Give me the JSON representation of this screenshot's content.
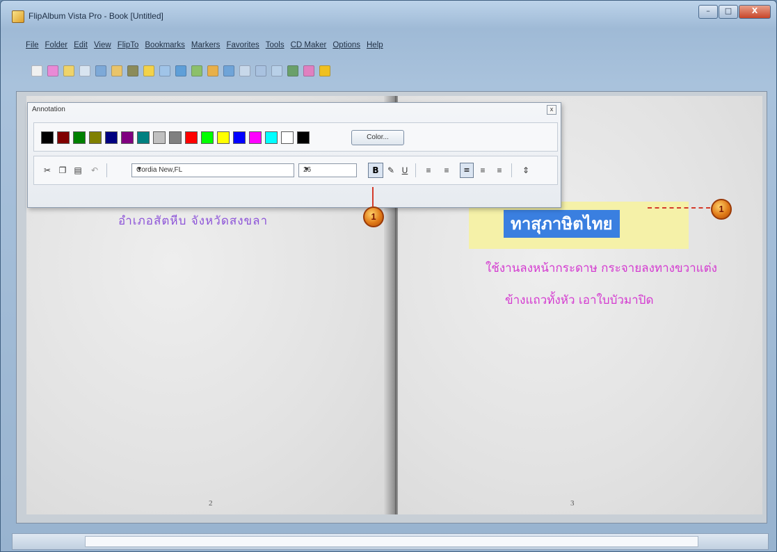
{
  "window": {
    "title": "FlipAlbum Vista Pro - Book [Untitled]",
    "controls": [
      "–",
      "□",
      "X"
    ]
  },
  "menu": {
    "items": [
      "File",
      "Folder",
      "Edit",
      "View",
      "FlipTo",
      "Bookmarks",
      "Markers",
      "Favorites",
      "Tools",
      "CD Maker",
      "Options",
      "Help"
    ]
  },
  "toolbar": {
    "icon_colors": [
      "#f0f0f0",
      "#e98ad6",
      "#efd36a",
      "#d8e4f0",
      "#7da9d8",
      "#e9c46a",
      "#8b8b5a",
      "#f3d24a",
      "#a0c4e8",
      "#5f9fd8",
      "#8cc06a",
      "#e8b04a",
      "#6fa4d8",
      "#c8d8ea",
      "#a9c2e0",
      "#b8d0e8",
      "#6aa06a",
      "#e080c0",
      "#f0c020"
    ]
  },
  "annotation_panel": {
    "title": "Annotation",
    "close_label": "x",
    "swatch_colors": [
      "#000000",
      "#800000",
      "#008000",
      "#808000",
      "#000080",
      "#800080",
      "#008080",
      "#c0c0c0",
      "#808080",
      "#ff0000",
      "#00ff00",
      "#ffff00",
      "#0000ff",
      "#ff00ff",
      "#00ffff",
      "#ffffff",
      "#000000"
    ],
    "color_button": "Color...",
    "font_value": "Cordia New,FL",
    "size_value": "26",
    "bold_label": "B",
    "center_label": "≡"
  },
  "book": {
    "left_page_text": "อำเภอสัตหีบ  จังหวัดสงขลา",
    "left_page_number": "2",
    "right_page_title": "ทาสุภาษิตไทย",
    "right_page_line1": "ใช้งานลงหน้ากระดาษ กระจายลงทางขวาแต่ง",
    "right_page_line2": "ข้างแถวทั้งหัว เอาใบบัวมาปิด",
    "right_page_number": "3"
  },
  "callouts": {
    "marker_label": "1"
  }
}
